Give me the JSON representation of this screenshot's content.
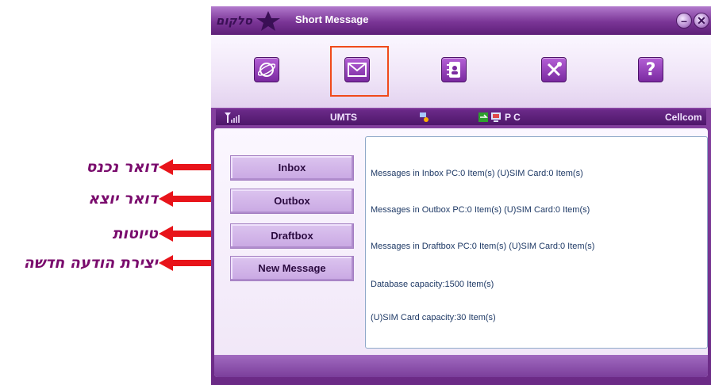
{
  "annotations": [
    {
      "label": "דואר נכנס"
    },
    {
      "label": "דואר יוצא"
    },
    {
      "label": "טיוטות"
    },
    {
      "label": "יצירת הודעה חדשה"
    }
  ],
  "window": {
    "logo_text": "סלקום",
    "title": "Short Message",
    "minimize_glyph": "–",
    "close_glyph": "✕"
  },
  "toolbar": {
    "tools": [
      {
        "name": "internet",
        "icon": "globe-icon"
      },
      {
        "name": "sms",
        "icon": "envelope-icon",
        "selected": true
      },
      {
        "name": "contacts",
        "icon": "phonebook-icon"
      },
      {
        "name": "settings",
        "icon": "tools-icon"
      },
      {
        "name": "help",
        "icon": "help-icon",
        "glyph": "?"
      }
    ]
  },
  "status_bar": {
    "network": "UMTS",
    "pc_label": "P C",
    "operator": "Cellcom"
  },
  "nav": {
    "inbox": "Inbox",
    "outbox": "Outbox",
    "draftbox": "Draftbox",
    "new_message": "New Message"
  },
  "info": {
    "inbox_line": "Messages in Inbox   PC:0 Item(s)  (U)SIM Card:0 Item(s)",
    "outbox_line": "Messages in Outbox  PC:0 Item(s)  (U)SIM Card:0 Item(s)",
    "draftbox_line": "Messages in Draftbox PC:0 Item(s)  (U)SIM Card:0 Item(s)",
    "database_capacity": "Database capacity:1500 Item(s)",
    "sim_capacity": "(U)SIM Card capacity:30 Item(s)"
  },
  "colors": {
    "annotation_text": "#7a0c6d",
    "arrow": "#e8141a",
    "selection_frame": "#f04a1a",
    "window_purple": "#7a3596"
  }
}
